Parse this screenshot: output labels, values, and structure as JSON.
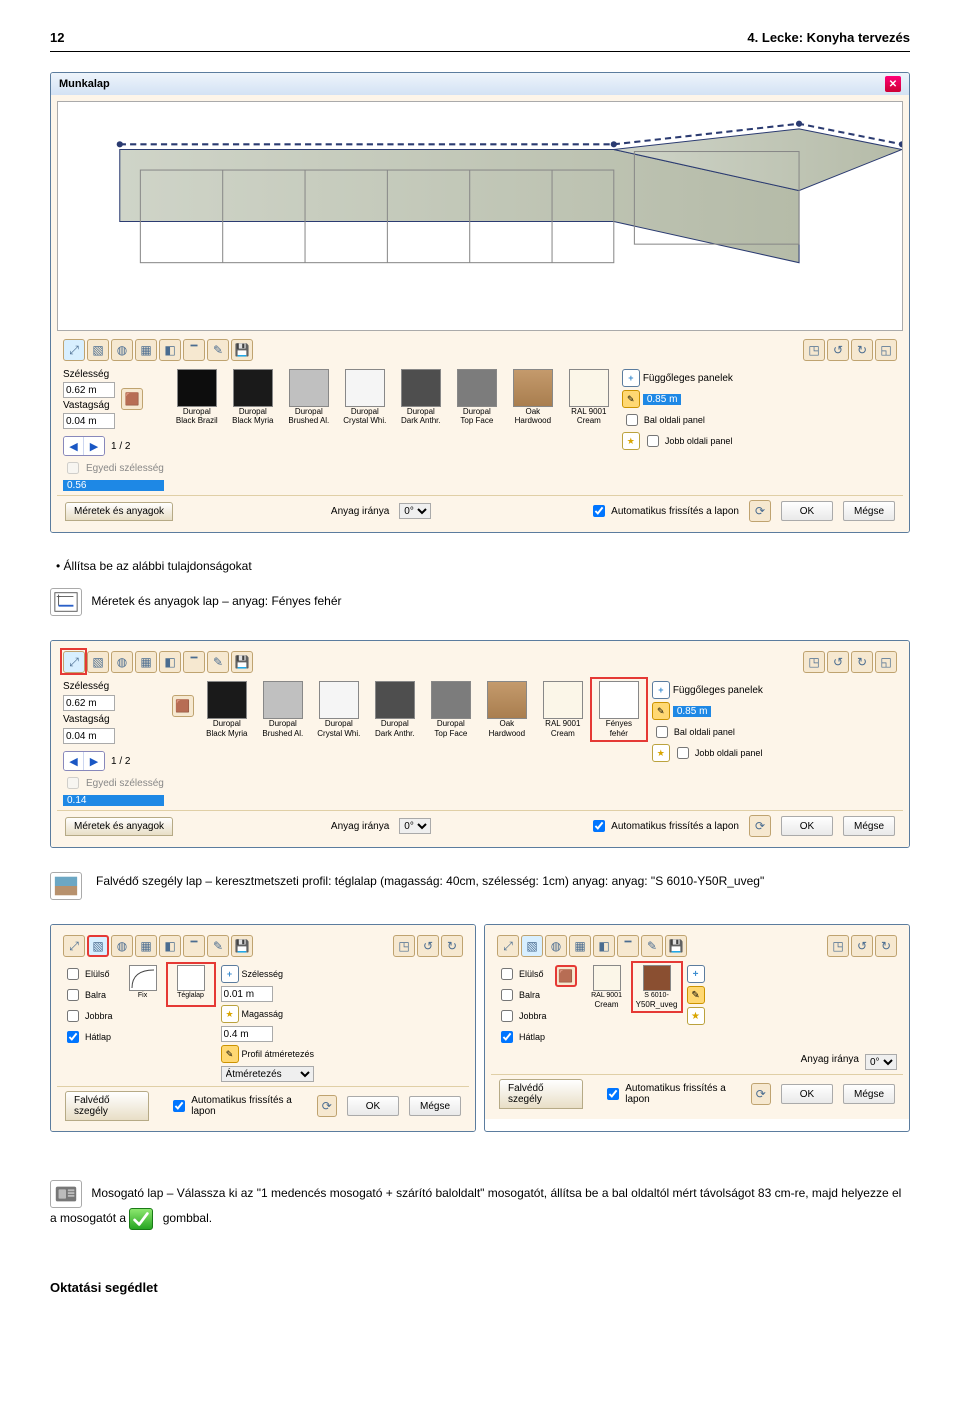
{
  "header": {
    "page": "12",
    "title": "4. Lecke: Konyha tervezés"
  },
  "dlg1": {
    "title": "Munkalap",
    "close": "✕",
    "szelesseg_label": "Szélesség",
    "szelesseg_value": "0.62 m",
    "vastagsag_label": "Vastagság",
    "vastagsag_value": "0.04 m",
    "pager": "1 / 2",
    "egyedi": "Egyedi szélesség",
    "hl_val": "0.56",
    "right_label": "Függőleges panelek",
    "right_val": "0.85 m",
    "bal_panel": "Bal oldali panel",
    "jobb_panel": "Jobb oldali panel",
    "tab": "Méretek és anyagok",
    "anyag_ir": "Anyag iránya",
    "deg0": "0°",
    "autof": "Automatikus frissítés a lapon",
    "ok": "OK",
    "megse": "Mégse",
    "mats": [
      {
        "name1": "Duropal",
        "name2": "Black Brazil",
        "fill": "#0d0d0d"
      },
      {
        "name1": "Duropal",
        "name2": "Black Myria",
        "fill": "#1a1a1a"
      },
      {
        "name1": "Duropal",
        "name2": "Brushed Al.",
        "fill": "#c0c0c0"
      },
      {
        "name1": "Duropal",
        "name2": "Crystal Whi.",
        "fill": "#f5f5f5"
      },
      {
        "name1": "Duropal",
        "name2": "Dark Anthr.",
        "fill": "#4e4e4e"
      },
      {
        "name1": "Duropal",
        "name2": "Top Face",
        "fill": "#7c7c7c"
      },
      {
        "name1": "Oak",
        "name2": "Hardwood",
        "fill": "linear-gradient(#c49a6c,#a97e4f)"
      },
      {
        "name1": "RAL 9001",
        "name2": "Cream",
        "fill": "#fbf6e8"
      }
    ],
    "refresh_icon": "⟳"
  },
  "bullet1": "Állítsa be az alábbi tulajdonságokat",
  "ico1_label": "Méretek és anyagok lap – anyag: Fényes fehér",
  "panel2": {
    "szelesseg_label": "Szélesség",
    "szelesseg_value": "0.62 m",
    "vastagsag_label": "Vastagság",
    "vastagsag_value": "0.04 m",
    "pager": "1 / 2",
    "egyedi": "Egyedi szélesség",
    "tab": "Méretek és anyagok",
    "anyag_ir": "Anyag iránya",
    "deg0": "0°",
    "autof": "Automatikus frissítés a lapon",
    "ok": "OK",
    "megse": "Mégse",
    "right_label": "Függőleges panelek",
    "right_val": "0.85 m",
    "bal_panel": "Bal oldali panel",
    "jobb_panel": "Jobb oldali panel",
    "hl_val": "0.14",
    "mats": [
      {
        "name1": "Duropal",
        "name2": "Black Myria",
        "fill": "#1a1a1a"
      },
      {
        "name1": "Duropal",
        "name2": "Brushed Al.",
        "fill": "#c0c0c0"
      },
      {
        "name1": "Duropal",
        "name2": "Crystal Whi.",
        "fill": "#f5f5f5"
      },
      {
        "name1": "Duropal",
        "name2": "Dark Anthr.",
        "fill": "#4e4e4e"
      },
      {
        "name1": "Duropal",
        "name2": "Top Face",
        "fill": "#7c7c7c"
      },
      {
        "name1": "Oak",
        "name2": "Hardwood",
        "fill": "linear-gradient(#c49a6c,#a97e4f)"
      },
      {
        "name1": "RAL 9001",
        "name2": "Cream",
        "fill": "#fbf6e8"
      },
      {
        "name1": "Fényes",
        "name2": "fehér",
        "fill": "#ffffff"
      }
    ]
  },
  "ico2_label": "Falvédő szegély lap – keresztmetszeti profil: téglalap (magasság: 40cm, szélesség: 1cm) anyag: anyag: \"S 6010-Y50R_uveg\"",
  "pair": {
    "left": {
      "chk": {
        "elulso": "Elülső",
        "balra": "Balra",
        "jobbra": "Jobbra",
        "hatlap": "Hátlap"
      },
      "fix": "Fix",
      "teglalap": "Téglalap",
      "sz_label": "Szélesség",
      "sz_value": "0.01 m",
      "ma_label": "Magasság",
      "ma_value": "0.4 m",
      "prof_atm": "Profil átméretezés",
      "atm": "Átméretezés",
      "tab": "Falvédő szegély",
      "autof": "Automatikus frissítés a lapon",
      "ok": "OK",
      "megse": "Mégse"
    },
    "right": {
      "chk": {
        "elulso": "Elülső",
        "balra": "Balra",
        "jobbra": "Jobbra",
        "hatlap": "Hátlap"
      },
      "mats": [
        {
          "name1": "RAL 9001",
          "name2": "Cream",
          "fill": "#fbf6e8"
        },
        {
          "name1": "S 6010-",
          "name2": "Y50R_uveg",
          "fill": "#8a4f31"
        }
      ],
      "anyag_ir": "Anyag iránya",
      "deg0": "0°",
      "tab": "Falvédő szegély",
      "autof": "Automatikus frissítés a lapon",
      "ok": "OK",
      "megse": "Mégse"
    }
  },
  "ico3_labelA": "Mosogató lap – Válassza ki az \"1 medencés mosogató + szárító baloldalt\" mosogatót, állítsa be a bal oldaltól mért távolságot 83 cm-re,  majd helyezze el a  mosogatót a ",
  "ico3_labelB": " gombbal.",
  "footer": "Oktatási segédlet"
}
